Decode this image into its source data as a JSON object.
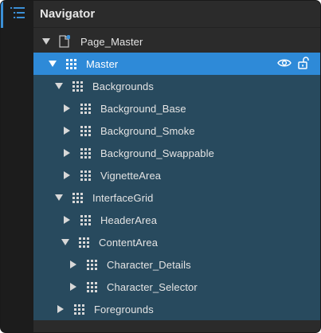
{
  "panel": {
    "title": "Navigator"
  },
  "sidebar": {
    "active_icon": "navigator-list-icon"
  },
  "tree": {
    "root": {
      "label": "Page_Master",
      "icon": "page-icon",
      "expanded": true
    },
    "master": {
      "label": "Master",
      "icon": "grid-icon",
      "expanded": true
    },
    "backgrounds": {
      "label": "Backgrounds",
      "icon": "grid-icon",
      "expanded": true
    },
    "background_base": {
      "label": "Background_Base",
      "icon": "grid-icon",
      "expanded": false
    },
    "background_smoke": {
      "label": "Background_Smoke",
      "icon": "grid-icon",
      "expanded": false
    },
    "background_swappable": {
      "label": "Background_Swappable",
      "icon": "grid-icon",
      "expanded": false
    },
    "vignette_area": {
      "label": "VignetteArea",
      "icon": "grid-icon",
      "expanded": false
    },
    "interface_grid": {
      "label": "InterfaceGrid",
      "icon": "grid-icon",
      "expanded": true
    },
    "header_area": {
      "label": "HeaderArea",
      "icon": "grid-icon",
      "expanded": false
    },
    "content_area": {
      "label": "ContentArea",
      "icon": "grid-icon",
      "expanded": true
    },
    "character_details": {
      "label": "Character_Details",
      "icon": "grid-icon",
      "expanded": false
    },
    "character_selector": {
      "label": "Character_Selector",
      "icon": "grid-icon",
      "expanded": false
    },
    "foregrounds": {
      "label": "Foregrounds",
      "icon": "grid-icon",
      "expanded": false
    }
  },
  "colors": {
    "selected_row": "#2e8ad8",
    "nested_row": "#284a5e",
    "accent_blue": "#3b8fd6",
    "panel_bg": "#2b2b2b"
  }
}
